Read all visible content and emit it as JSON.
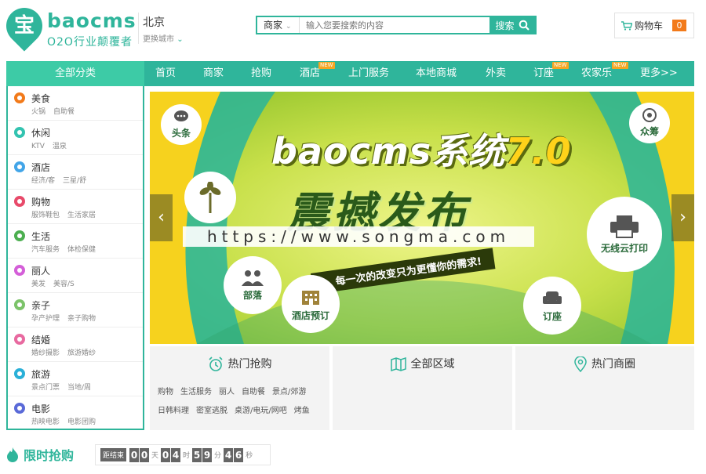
{
  "logo": {
    "badge_char": "宝",
    "name": "baocms",
    "slogan": "O2O行业颠覆者"
  },
  "city": {
    "name": "北京",
    "switch_label": "更换城市"
  },
  "search": {
    "type": "商家",
    "placeholder": "输入您要搜索的内容",
    "button": "搜索"
  },
  "cart": {
    "label": "购物车",
    "count": "0"
  },
  "nav": {
    "all_label": "全部分类",
    "items": [
      {
        "label": "首页",
        "new": false
      },
      {
        "label": "商家",
        "new": false
      },
      {
        "label": "抢购",
        "new": false
      },
      {
        "label": "酒店",
        "new": true
      },
      {
        "label": "上门服务",
        "new": false
      },
      {
        "label": "本地商城",
        "new": false
      },
      {
        "label": "外卖",
        "new": false
      },
      {
        "label": "订座",
        "new": true
      },
      {
        "label": "农家乐",
        "new": true
      },
      {
        "label": "更多>>",
        "new": false
      }
    ],
    "new_badge": "NEW"
  },
  "categories": [
    {
      "title": "美食",
      "subs": [
        "火锅",
        "自助餐"
      ],
      "color": "#f27a1a"
    },
    {
      "title": "休闲",
      "subs": [
        "KTV",
        "温泉"
      ],
      "color": "#33c3b0"
    },
    {
      "title": "酒店",
      "subs": [
        "经济/客",
        "三星/舒"
      ],
      "color": "#42a5e8"
    },
    {
      "title": "购物",
      "subs": [
        "服饰鞋包",
        "生活家居"
      ],
      "color": "#e84a6a"
    },
    {
      "title": "生活",
      "subs": [
        "汽车服务",
        "体检保健"
      ],
      "color": "#4caf50"
    },
    {
      "title": "丽人",
      "subs": [
        "美发",
        "美容/S"
      ],
      "color": "#d45fd8"
    },
    {
      "title": "亲子",
      "subs": [
        "孕产护理",
        "亲子购物"
      ],
      "color": "#7cc36a"
    },
    {
      "title": "结婚",
      "subs": [
        "婚纱摄影",
        "旅游婚纱"
      ],
      "color": "#e86aa0"
    },
    {
      "title": "旅游",
      "subs": [
        "景点门票",
        "当地/周"
      ],
      "color": "#2ab0d8"
    },
    {
      "title": "电影",
      "subs": [
        "热映电影",
        "电影团购"
      ],
      "color": "#5a6ad8"
    }
  ],
  "banner": {
    "title_brand": "baocms系统",
    "title_version": "7.0",
    "subtitle": "震撼发布",
    "slogan": "每一次的改变只为更懂你的需求!",
    "watermark": "https://www.songma.com",
    "bubbles": [
      "头条",
      "众筹",
      "部落",
      "酒店预订",
      "无线云打印",
      "订座"
    ],
    "prev": "‹",
    "next": "›"
  },
  "info_boxes": [
    {
      "title": "热门抢购",
      "icon": "alarm-clock-icon",
      "tags": [
        "购物",
        "生活服务",
        "丽人",
        "自助餐",
        "景点/郊游",
        "日韩料理",
        "密室逃脱",
        "桌游/电玩/网吧",
        "烤鱼"
      ]
    },
    {
      "title": "全部区域",
      "icon": "map-icon",
      "tags": []
    },
    {
      "title": "热门商圈",
      "icon": "location-pin-icon",
      "tags": []
    }
  ],
  "flash": {
    "title": "限时抢购",
    "countdown_label": "距结束",
    "days": [
      "0",
      "0"
    ],
    "days_unit": "天",
    "hours": [
      "0",
      "4"
    ],
    "hours_unit": "时",
    "minutes": [
      "5",
      "9"
    ],
    "minutes_unit": "分",
    "seconds": [
      "4",
      "6"
    ],
    "seconds_unit": "秒"
  },
  "colors": {
    "brand": "#2fb59b",
    "nav_all": "#3dcba6",
    "cart_badge": "#f27a1a",
    "new_badge": "#f5a623"
  }
}
